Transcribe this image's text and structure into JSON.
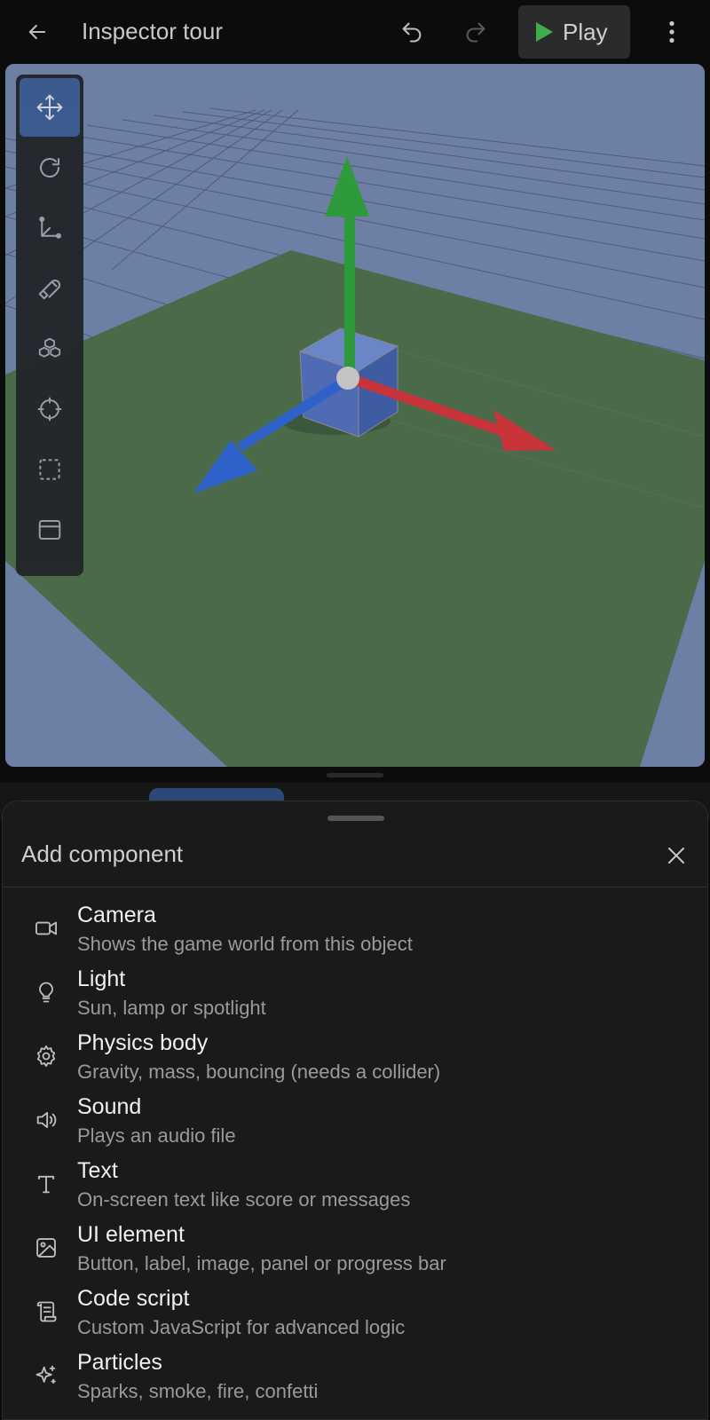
{
  "header": {
    "title": "Inspector tour",
    "play_label": "Play"
  },
  "toolbar": {
    "tools": [
      {
        "icon": "move-icon",
        "active": true
      },
      {
        "icon": "rotate-icon",
        "active": false
      },
      {
        "icon": "scale-icon",
        "active": false
      },
      {
        "icon": "snap-magnet-icon",
        "active": false
      },
      {
        "icon": "add-object-icon",
        "active": false
      },
      {
        "icon": "focus-target-icon",
        "active": false
      },
      {
        "icon": "select-box-icon",
        "active": false
      },
      {
        "icon": "window-icon",
        "active": false
      }
    ]
  },
  "gizmo_colors": {
    "x": "#c8343a",
    "y": "#2f9a3c",
    "z": "#2f62c8"
  },
  "sheet": {
    "title": "Add component",
    "items": [
      {
        "icon": "camera-icon",
        "label": "Camera",
        "desc": "Shows the game world from this object"
      },
      {
        "icon": "lightbulb-icon",
        "label": "Light",
        "desc": "Sun, lamp or spotlight"
      },
      {
        "icon": "gear-icon",
        "label": "Physics body",
        "desc": "Gravity, mass, bouncing (needs a collider)"
      },
      {
        "icon": "speaker-icon",
        "label": "Sound",
        "desc": "Plays an audio file"
      },
      {
        "icon": "text-icon",
        "label": "Text",
        "desc": "On-screen text like score or messages"
      },
      {
        "icon": "image-icon",
        "label": "UI element",
        "desc": "Button, label, image, panel or progress bar"
      },
      {
        "icon": "script-icon",
        "label": "Code script",
        "desc": "Custom JavaScript for advanced logic"
      },
      {
        "icon": "sparkles-icon",
        "label": "Particles",
        "desc": "Sparks, smoke, fire, confetti"
      }
    ]
  }
}
